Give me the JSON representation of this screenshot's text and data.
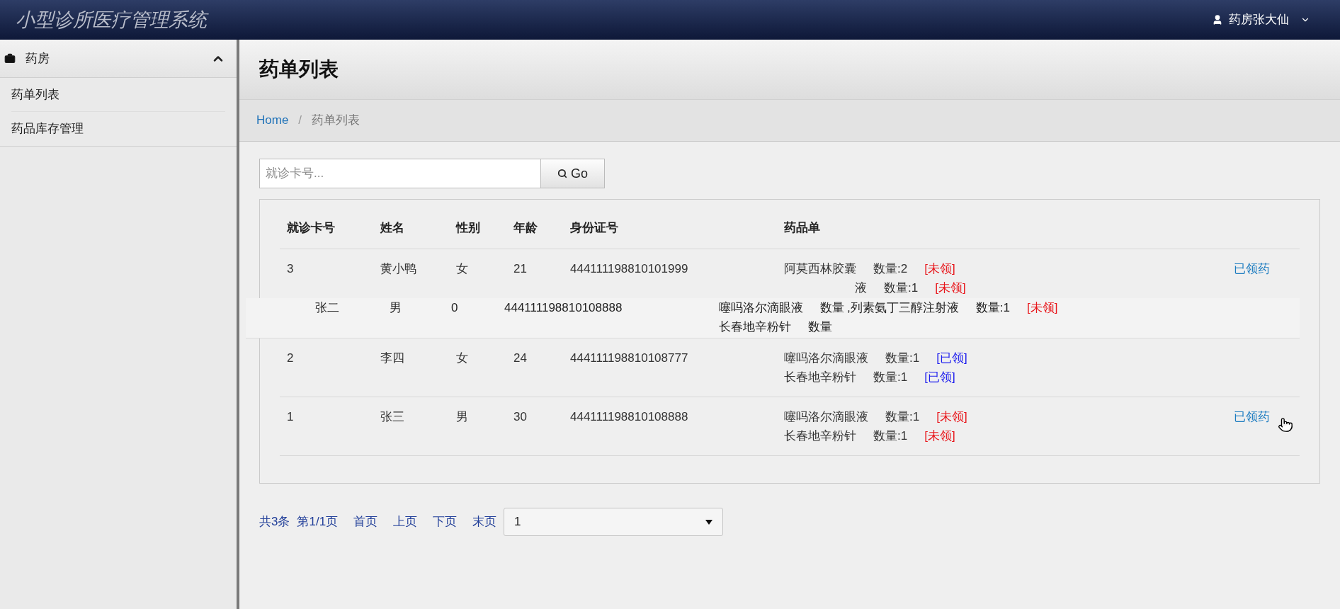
{
  "app_title": "小型诊所医疗管理系统",
  "user": {
    "name": "药房张大仙"
  },
  "sidebar": {
    "group": {
      "label": "药房",
      "expanded": true,
      "items": [
        {
          "label": "药单列表"
        },
        {
          "label": "药品库存管理"
        }
      ]
    }
  },
  "page_title": "药单列表",
  "breadcrumb": {
    "separator": "/",
    "items": [
      {
        "label": "Home",
        "kind": "link"
      },
      {
        "label": "药单列表",
        "kind": "current"
      }
    ]
  },
  "search": {
    "placeholder": "就诊卡号...",
    "button": "Go"
  },
  "table": {
    "columns": [
      "就诊卡号",
      "姓名",
      "性别",
      "年龄",
      "身份证号",
      "药品单"
    ],
    "rows": [
      {
        "card": "3",
        "name": "黄小鸭",
        "gender": "女",
        "age": "21",
        "id": "444111198810101999",
        "action": "已领药",
        "drugs": [
          {
            "kind": "full",
            "name": "阿莫西林胶囊",
            "qty": "数量:2",
            "status": "[未领]",
            "taken": false
          },
          {
            "kind": "fragment",
            "name": "液",
            "qty": "数量:1",
            "status": "[未领]",
            "taken": false
          }
        ]
      },
      {
        "card": "2",
        "name": "李四",
        "gender": "女",
        "age": "24",
        "id": "444111198810108777",
        "drugs": [
          {
            "kind": "full",
            "name": "噻吗洛尔滴眼液",
            "qty": "数量:1",
            "status": "[已领]",
            "taken": true
          },
          {
            "kind": "full",
            "name": "长春地辛粉针",
            "qty": "数量:1",
            "status": "[已领]",
            "taken": true
          }
        ]
      },
      {
        "card": "1",
        "name": "张三",
        "gender": "男",
        "age": "30",
        "id": "444111198810108888",
        "action": "已领药",
        "drugs": [
          {
            "kind": "full",
            "name": "噻吗洛尔滴眼液",
            "qty": "数量:1",
            "status": "[未领]",
            "taken": false
          },
          {
            "kind": "full",
            "name": "长春地辛粉针",
            "qty": "数量:1",
            "status": "[未领]",
            "taken": false
          }
        ]
      }
    ]
  },
  "overlay_row": {
    "name": "张二",
    "gender": "男",
    "age": "0",
    "id": "444111198810108888",
    "drugs": [
      {
        "name": "噻吗洛尔滴眼液",
        "qty": "数量"
      },
      {
        "name": "长春地辛粉针",
        "qty": "数量"
      }
    ],
    "trailing": {
      "name": ",列素氨丁三醇注射液",
      "qty": "数量:1",
      "status": "[未领]",
      "taken": false
    }
  },
  "pagination": {
    "summary": "共3条",
    "page_info": "第1/1页",
    "links": [
      "首页",
      "上页",
      "下页",
      "末页"
    ],
    "select": "1"
  }
}
